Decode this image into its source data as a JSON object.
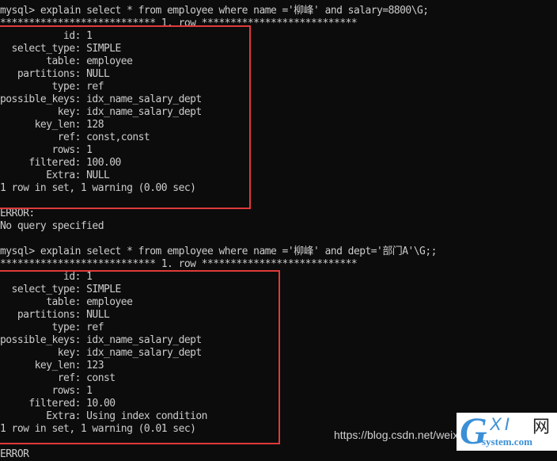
{
  "terminal": {
    "lines": [
      "mysql> explain select * from employee where name ='柳峰' and salary=8800\\G;",
      "*************************** 1. row ***************************",
      "           id: 1",
      "  select_type: SIMPLE",
      "        table: employee",
      "   partitions: NULL",
      "         type: ref",
      "possible_keys: idx_name_salary_dept",
      "          key: idx_name_salary_dept",
      "      key_len: 128",
      "          ref: const,const",
      "         rows: 1",
      "     filtered: 100.00",
      "        Extra: NULL",
      "1 row in set, 1 warning (0.00 sec)",
      "",
      "ERROR:",
      "No query specified",
      "",
      "mysql> explain select * from employee where name ='柳峰' and dept='部门A'\\G;;",
      "*************************** 1. row ***************************",
      "           id: 1",
      "  select_type: SIMPLE",
      "        table: employee",
      "   partitions: NULL",
      "         type: ref",
      "possible_keys: idx_name_salary_dept",
      "          key: idx_name_salary_dept",
      "      key_len: 123",
      "          ref: const",
      "         rows: 1",
      "     filtered: 10.00",
      "        Extra: Using index condition",
      "1 row in set, 1 warning (0.01 sec)",
      "",
      "ERROR"
    ]
  },
  "highlight_color": "#e03a3a",
  "watermark": {
    "url_text": "https://blog.csdn.net/weixi",
    "logo_g": "G",
    "logo_xi": "XI",
    "logo_wang": "网",
    "logo_domain": "system.com"
  }
}
